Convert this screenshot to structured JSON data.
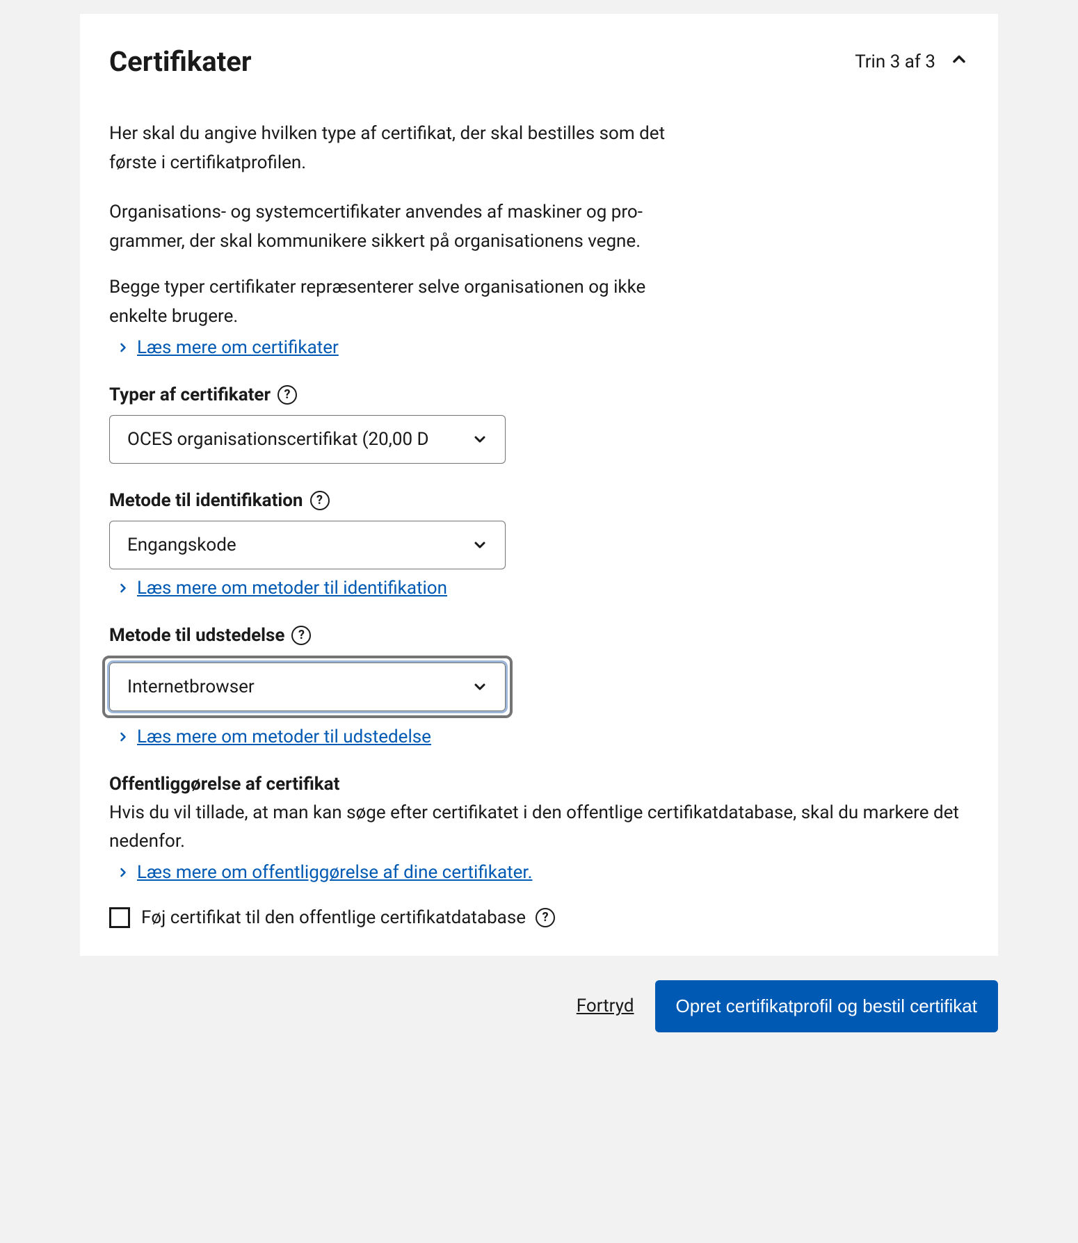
{
  "header": {
    "title": "Certifikater",
    "step": "Trin 3 af 3"
  },
  "intro": {
    "p1": "Her skal du angive hvilken type af certifikat, der skal bestilles som det første i certifikatprofilen.",
    "p2": "Organisations- og systemcertifikater anvendes af maskiner og pro­grammer, der skal kommunikere sikkert på organisationens vegne.",
    "p3": "Begge typer certifikater repræsenterer selve organisationen og ikke enkelte brugere.",
    "link1": "Læs mere om certifikater"
  },
  "fields": {
    "type": {
      "label": "Typer af certifikater",
      "value": "OCES organisationscertifikat (20,00 D"
    },
    "ident": {
      "label": "Metode til identifikation",
      "value": "Engangskode",
      "link": "Læs mere om metoder til identifikation"
    },
    "issuance": {
      "label": "Metode til udstedelse",
      "value": "Internetbrowser",
      "link": "Læs mere om metoder til udstedelse"
    }
  },
  "publication": {
    "heading": "Offentliggørelse af certifikat",
    "text": "Hvis du vil tillade, at man kan søge efter certifikatet i den offentlige certifikatdatabase, skal du markere det nedenfor.",
    "link": "Læs mere om offentliggørelse af dine certifikater.",
    "checkbox_label": "Føj certifikat til den offentlige certifikatdatabase"
  },
  "footer": {
    "cancel": "Fortryd",
    "submit": "Opret certifikatprofil og bestil certifikat"
  }
}
